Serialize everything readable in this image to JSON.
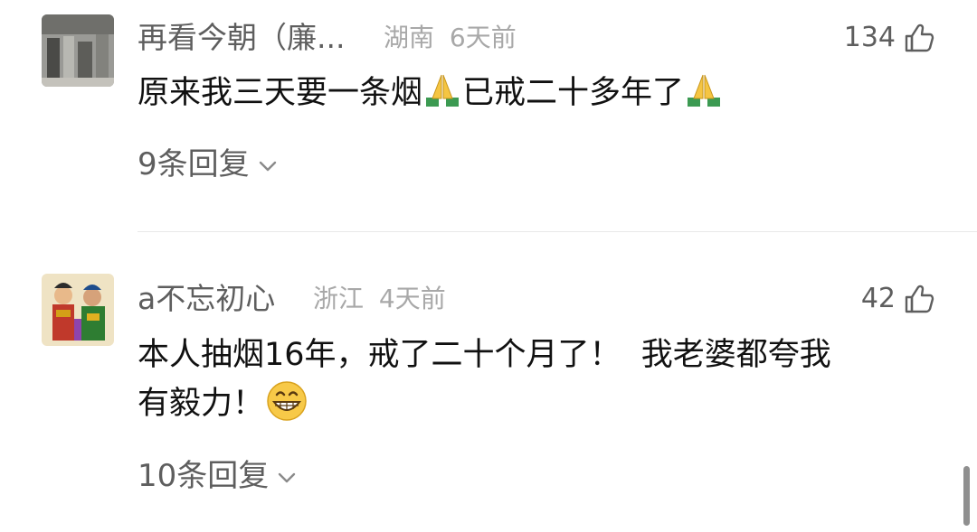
{
  "comments": [
    {
      "username": "再看今朝（廉...",
      "location": "湖南",
      "time": "6天前",
      "likes": "134",
      "text_before_emoji1": "原来我三天要一条烟",
      "text_between": "已戒二十多年了",
      "emoji": "folded-hands",
      "replies_label": "9条回复",
      "avatar_icon": "building-photo-avatar"
    },
    {
      "username": "a不忘初心",
      "location": "浙江",
      "time": "4天前",
      "likes": "42",
      "text_line1": "本人抽烟16年，戒了二十个月了！  我老婆都夸我",
      "text_line2": "有毅力！",
      "emoji": "grinning-face",
      "replies_label": "10条回复",
      "avatar_icon": "door-gods-avatar"
    }
  ],
  "icons": {
    "like": "thumbs-up-outline",
    "expand": "chevron-down"
  },
  "colors": {
    "username": "#5e5e5e",
    "meta": "#a8a8a8",
    "text": "#111111",
    "divider": "#e8e8e8"
  }
}
